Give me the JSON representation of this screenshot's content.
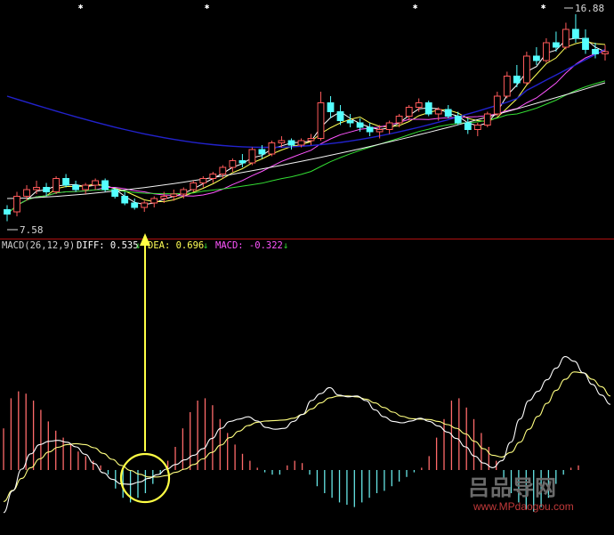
{
  "chart_data": [
    {
      "type": "candlestick",
      "price_labels": {
        "high": "16.88",
        "low": "7.58"
      },
      "moving_average_colors": [
        "#ffffff",
        "#ffff55",
        "#ff55ff",
        "#33dd33",
        "#f2f2f2",
        "#2222cc"
      ],
      "candles": [
        [
          8.1,
          8.3,
          7.58,
          7.9
        ],
        [
          8.0,
          8.9,
          7.8,
          8.7
        ],
        [
          8.7,
          9.2,
          8.5,
          9.0
        ],
        [
          9.0,
          9.4,
          8.8,
          9.1
        ],
        [
          9.1,
          9.3,
          8.7,
          8.9
        ],
        [
          8.9,
          9.6,
          8.8,
          9.5
        ],
        [
          9.5,
          9.7,
          9.1,
          9.2
        ],
        [
          9.2,
          9.4,
          8.9,
          9.0
        ],
        [
          9.0,
          9.3,
          8.8,
          9.2
        ],
        [
          9.2,
          9.5,
          9.0,
          9.4
        ],
        [
          9.4,
          9.5,
          8.9,
          9.0
        ],
        [
          9.0,
          9.1,
          8.6,
          8.7
        ],
        [
          8.7,
          8.9,
          8.3,
          8.4
        ],
        [
          8.4,
          8.6,
          8.1,
          8.2
        ],
        [
          8.2,
          8.5,
          8.0,
          8.4
        ],
        [
          8.4,
          8.7,
          8.2,
          8.6
        ],
        [
          8.6,
          8.9,
          8.4,
          8.7
        ],
        [
          8.7,
          9.0,
          8.5,
          8.8
        ],
        [
          8.8,
          9.1,
          8.6,
          9.0
        ],
        [
          9.0,
          9.4,
          8.9,
          9.3
        ],
        [
          9.3,
          9.6,
          9.1,
          9.5
        ],
        [
          9.5,
          9.8,
          9.3,
          9.7
        ],
        [
          9.7,
          10.1,
          9.5,
          10.0
        ],
        [
          10.0,
          10.4,
          9.8,
          10.3
        ],
        [
          10.3,
          10.6,
          10.0,
          10.2
        ],
        [
          10.2,
          10.9,
          10.1,
          10.8
        ],
        [
          10.8,
          11.0,
          10.4,
          10.6
        ],
        [
          10.6,
          11.2,
          10.5,
          11.1
        ],
        [
          11.1,
          11.4,
          10.9,
          11.2
        ],
        [
          11.2,
          11.3,
          10.8,
          11.0
        ],
        [
          11.0,
          11.3,
          10.9,
          11.2
        ],
        [
          11.2,
          11.5,
          11.0,
          11.3
        ],
        [
          11.3,
          13.4,
          11.2,
          12.9
        ],
        [
          12.9,
          13.2,
          12.2,
          12.5
        ],
        [
          12.5,
          12.8,
          11.9,
          12.1
        ],
        [
          12.1,
          12.4,
          11.8,
          12.0
        ],
        [
          12.0,
          12.2,
          11.6,
          11.8
        ],
        [
          11.8,
          12.0,
          11.4,
          11.6
        ],
        [
          11.6,
          11.9,
          11.3,
          11.7
        ],
        [
          11.7,
          12.1,
          11.5,
          12.0
        ],
        [
          12.0,
          12.4,
          11.8,
          12.3
        ],
        [
          12.3,
          12.8,
          12.1,
          12.7
        ],
        [
          12.7,
          13.1,
          12.5,
          12.9
        ],
        [
          12.9,
          13.0,
          12.3,
          12.4
        ],
        [
          12.4,
          12.7,
          12.1,
          12.6
        ],
        [
          12.6,
          12.8,
          12.2,
          12.3
        ],
        [
          12.3,
          12.5,
          11.9,
          12.0
        ],
        [
          12.0,
          12.2,
          11.5,
          11.7
        ],
        [
          11.7,
          12.0,
          11.4,
          11.9
        ],
        [
          11.9,
          12.5,
          11.8,
          12.4
        ],
        [
          12.4,
          13.4,
          12.3,
          13.2
        ],
        [
          13.2,
          14.3,
          13.1,
          14.1
        ],
        [
          14.1,
          14.6,
          13.6,
          13.8
        ],
        [
          13.8,
          15.2,
          13.7,
          15.0
        ],
        [
          15.0,
          15.4,
          14.6,
          14.8
        ],
        [
          14.8,
          15.8,
          14.7,
          15.6
        ],
        [
          15.6,
          16.1,
          15.2,
          15.4
        ],
        [
          15.4,
          16.5,
          15.3,
          16.2
        ],
        [
          16.2,
          16.88,
          15.6,
          15.8
        ],
        [
          15.8,
          16.2,
          15.1,
          15.3
        ],
        [
          15.3,
          15.6,
          14.9,
          15.1
        ],
        [
          15.1,
          15.5,
          14.8,
          15.2
        ]
      ]
    },
    {
      "type": "line",
      "indicator": "MACD",
      "params": "MACD(26,12,9)",
      "legend": [
        {
          "label": "DIFF: 0.535",
          "color": "#ffffff"
        },
        {
          "label": "DEA: 0.696",
          "color": "#ffff55"
        },
        {
          "label": "MACD: -0.322",
          "color": "#ff55ff"
        }
      ],
      "diff": [
        -0.92,
        -0.45,
        0.02,
        0.35,
        0.55,
        0.62,
        0.64,
        0.6,
        0.5,
        0.34,
        0.14,
        -0.06,
        -0.2,
        -0.3,
        -0.31,
        -0.26,
        -0.18,
        -0.1,
        0.02,
        0.12,
        0.22,
        0.32,
        0.46,
        0.68,
        0.9,
        1.05,
        1.1,
        1.15,
        1.06,
        0.92,
        0.88,
        0.9,
        1.05,
        1.2,
        1.5,
        1.65,
        1.78,
        1.62,
        1.58,
        1.6,
        1.5,
        1.3,
        1.15,
        1.05,
        1.02,
        1.06,
        1.12,
        1.05,
        0.95,
        0.82,
        0.68,
        0.5,
        0.3,
        0.15,
        0.05,
        0.2,
        0.6,
        1.1,
        1.5,
        1.7,
        1.95,
        2.2,
        2.45,
        2.35,
        2.1,
        1.85,
        1.62,
        1.42
      ],
      "dea": [
        -0.68,
        -0.44,
        -0.18,
        0.05,
        0.24,
        0.39,
        0.49,
        0.55,
        0.57,
        0.55,
        0.48,
        0.36,
        0.23,
        0.1,
        -0.01,
        -0.09,
        -0.15,
        -0.15,
        -0.12,
        -0.05,
        0.02,
        0.12,
        0.24,
        0.38,
        0.54,
        0.7,
        0.84,
        0.96,
        1.03,
        1.06,
        1.07,
        1.08,
        1.12,
        1.2,
        1.32,
        1.45,
        1.56,
        1.6,
        1.6,
        1.58,
        1.53,
        1.45,
        1.35,
        1.25,
        1.16,
        1.11,
        1.1,
        1.09,
        1.05,
        0.98,
        0.9,
        0.78,
        0.62,
        0.46,
        0.32,
        0.28,
        0.38,
        0.6,
        0.88,
        1.16,
        1.44,
        1.72,
        1.96,
        2.12,
        2.1,
        1.96,
        1.8,
        1.6
      ],
      "hist": [
        0.9,
        1.55,
        1.7,
        1.65,
        1.5,
        1.3,
        1.05,
        0.85,
        0.7,
        0.55,
        0.4,
        0.3,
        0.2,
        0.1,
        -0.1,
        -0.4,
        -0.6,
        -0.7,
        -0.6,
        -0.5,
        -0.3,
        -0.1,
        0.2,
        0.5,
        0.9,
        1.25,
        1.5,
        1.55,
        1.4,
        1.1,
        0.8,
        0.55,
        0.35,
        0.2,
        0.05,
        -0.05,
        -0.1,
        -0.1,
        0.1,
        0.2,
        0.15,
        -0.1,
        -0.35,
        -0.5,
        -0.6,
        -0.7,
        -0.75,
        -0.8,
        -0.7,
        -0.6,
        -0.5,
        -0.45,
        -0.35,
        -0.25,
        -0.15,
        -0.05,
        0.05,
        0.3,
        0.7,
        1.1,
        1.5,
        1.55,
        1.35,
        1.1,
        0.8,
        0.5,
        0.2,
        -0.2,
        -0.5,
        -0.7,
        -0.85,
        -0.9,
        -0.8,
        -0.6,
        -0.3,
        -0.1,
        0.05,
        0.1
      ],
      "arrow_annotation": "golden cross marker"
    }
  ],
  "watermark": {
    "brand": "吕品导网",
    "url": "www.MPdaogou.com"
  }
}
